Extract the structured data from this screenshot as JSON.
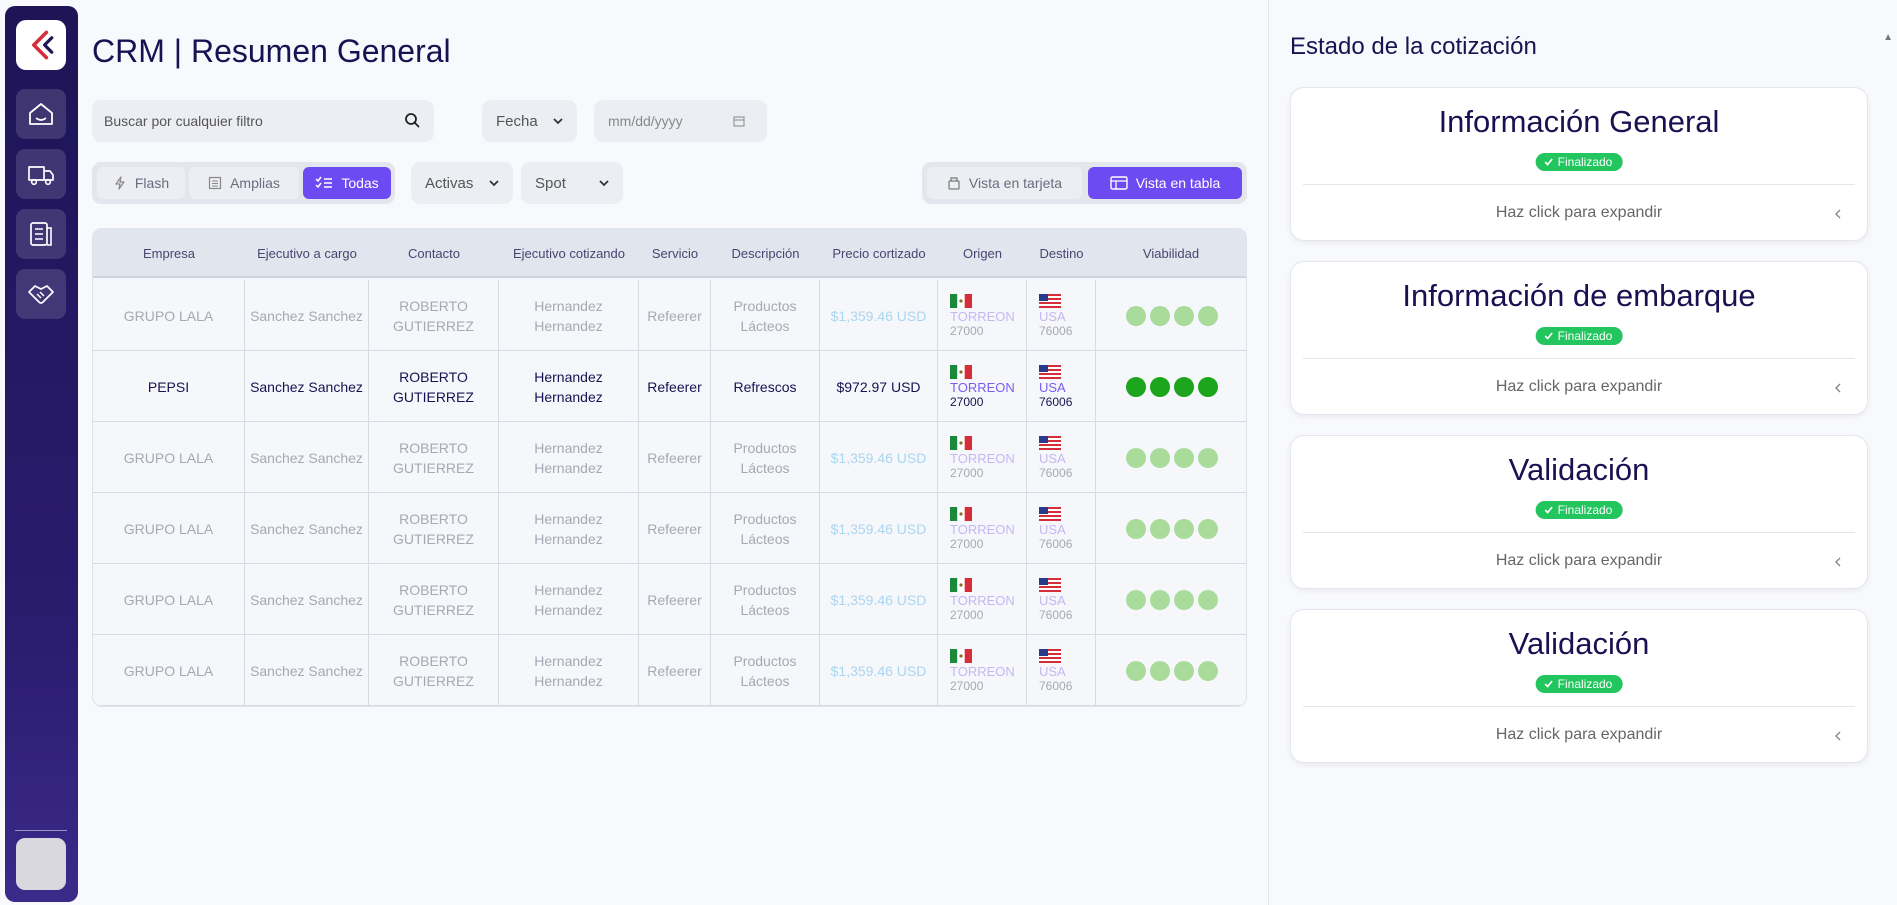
{
  "page": {
    "title": "CRM | Resumen General"
  },
  "filters": {
    "search_placeholder": "Buscar por cualquier filtro",
    "date_select": "Fecha",
    "date_input": "mm/dd/yyyy",
    "status_select": "Activas",
    "type_select": "Spot"
  },
  "segments": {
    "flash": "Flash",
    "amplias": "Amplias",
    "todas": "Todas",
    "active": "Todas"
  },
  "views": {
    "card": "Vista en tarjeta",
    "table": "Vista en tabla",
    "active": "table"
  },
  "table": {
    "headers": [
      "Empresa",
      "Ejecutivo a cargo",
      "Contacto",
      "Ejecutivo cotizando",
      "Servicio",
      "Descripción",
      "Precio cortizado",
      "Origen",
      "Destino",
      "Viabilidad"
    ],
    "rows": [
      {
        "empresa": "GRUPO LALA",
        "ejecutivo": "Sanchez Sanchez",
        "contacto_1": "ROBERTO",
        "contacto_2": "GUTIERREZ",
        "cotizando_1": "Hernandez",
        "cotizando_2": "Hernandez",
        "servicio": "Refeerer",
        "desc_1": "Productos",
        "desc_2": "Lácteos",
        "precio": "$1,359.46 USD",
        "origen_city": "TORREON",
        "origen_zip": "27000",
        "destino_city": "USA",
        "destino_zip": "76006",
        "viabilidad": 4,
        "highlighted": false
      },
      {
        "empresa": "PEPSI",
        "ejecutivo": "Sanchez Sanchez",
        "contacto_1": "ROBERTO",
        "contacto_2": "GUTIERREZ",
        "cotizando_1": "Hernandez",
        "cotizando_2": "Hernandez",
        "servicio": "Refeerer",
        "desc_1": "Refrescos",
        "desc_2": "",
        "precio": "$972.97 USD",
        "origen_city": "TORREON",
        "origen_zip": "27000",
        "destino_city": "USA",
        "destino_zip": "76006",
        "viabilidad": 4,
        "highlighted": true
      },
      {
        "empresa": "GRUPO LALA",
        "ejecutivo": "Sanchez Sanchez",
        "contacto_1": "ROBERTO",
        "contacto_2": "GUTIERREZ",
        "cotizando_1": "Hernandez",
        "cotizando_2": "Hernandez",
        "servicio": "Refeerer",
        "desc_1": "Productos",
        "desc_2": "Lácteos",
        "precio": "$1,359.46 USD",
        "origen_city": "TORREON",
        "origen_zip": "27000",
        "destino_city": "USA",
        "destino_zip": "76006",
        "viabilidad": 4,
        "highlighted": false
      },
      {
        "empresa": "GRUPO LALA",
        "ejecutivo": "Sanchez Sanchez",
        "contacto_1": "ROBERTO",
        "contacto_2": "GUTIERREZ",
        "cotizando_1": "Hernandez",
        "cotizando_2": "Hernandez",
        "servicio": "Refeerer",
        "desc_1": "Productos",
        "desc_2": "Lácteos",
        "precio": "$1,359.46 USD",
        "origen_city": "TORREON",
        "origen_zip": "27000",
        "destino_city": "USA",
        "destino_zip": "76006",
        "viabilidad": 4,
        "highlighted": false
      },
      {
        "empresa": "GRUPO LALA",
        "ejecutivo": "Sanchez Sanchez",
        "contacto_1": "ROBERTO",
        "contacto_2": "GUTIERREZ",
        "cotizando_1": "Hernandez",
        "cotizando_2": "Hernandez",
        "servicio": "Refeerer",
        "desc_1": "Productos",
        "desc_2": "Lácteos",
        "precio": "$1,359.46 USD",
        "origen_city": "TORREON",
        "origen_zip": "27000",
        "destino_city": "USA",
        "destino_zip": "76006",
        "viabilidad": 4,
        "highlighted": false
      },
      {
        "empresa": "GRUPO LALA",
        "ejecutivo": "Sanchez Sanchez",
        "contacto_1": "ROBERTO",
        "contacto_2": "GUTIERREZ",
        "cotizando_1": "Hernandez",
        "cotizando_2": "Hernandez",
        "servicio": "Refeerer",
        "desc_1": "Productos",
        "desc_2": "Lácteos",
        "precio": "$1,359.46 USD",
        "origen_city": "TORREON",
        "origen_zip": "27000",
        "destino_city": "USA",
        "destino_zip": "76006",
        "viabilidad": 4,
        "highlighted": false
      }
    ]
  },
  "panel": {
    "title": "Estado de la cotización",
    "cards": [
      {
        "title": "Información General",
        "status": "Finalizado",
        "expand": "Haz click para expandir"
      },
      {
        "title": "Información de embarque",
        "status": "Finalizado",
        "expand": "Haz click para expandir"
      },
      {
        "title": "Validación",
        "status": "Finalizado",
        "expand": "Haz click para expandir"
      },
      {
        "title": "Validación",
        "status": "Finalizado",
        "expand": "Haz click para expandir"
      }
    ]
  },
  "colors": {
    "accent": "#6e4af2",
    "sidebar": "#1e1456",
    "success": "#22c55e",
    "viability": "#1ea51e"
  },
  "icons": {
    "logo": "company-logo",
    "nav": [
      "home-icon",
      "truck-icon",
      "document-icon",
      "handshake-icon"
    ]
  }
}
